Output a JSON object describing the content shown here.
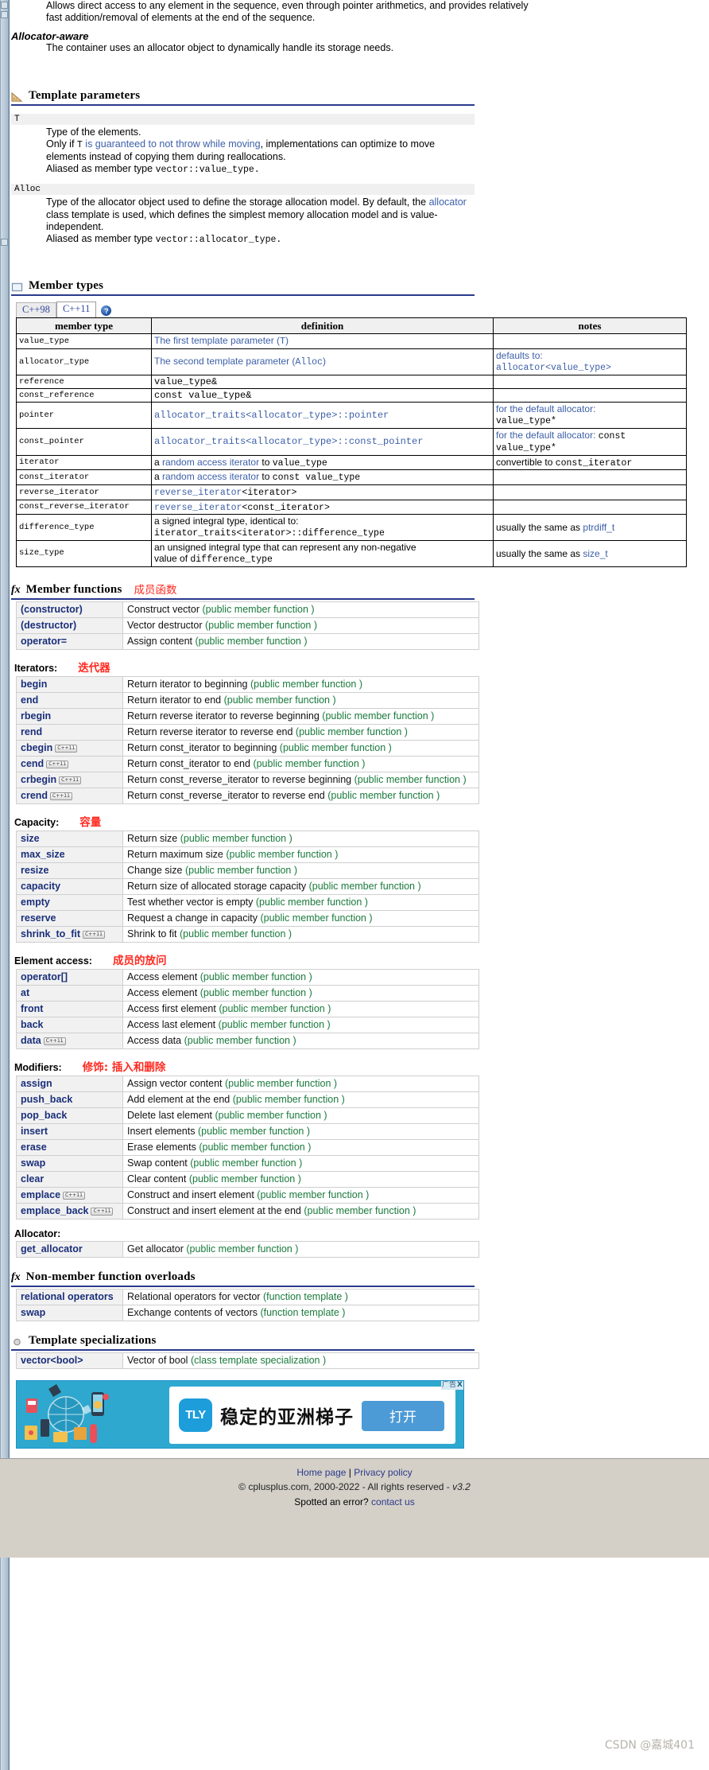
{
  "intro": {
    "line1": "Allows direct access to any element in the sequence, even through pointer arithmetics, and provides relatively",
    "line2": "fast addition/removal of elements at the end of the sequence.",
    "allocator_aware_title": "Allocator-aware",
    "allocator_aware_text": "The container uses an allocator object to dynamically handle its storage needs."
  },
  "template_parameters": {
    "heading": "Template parameters",
    "icon": "ruler-icon",
    "params": [
      {
        "name": "T",
        "lines": [
          "Type of the elements.",
          "Only if T is guaranteed to not throw while moving, implementations can optimize to move elements instead of copying them during reallocations.",
          "Aliased as member type vector::value_type."
        ],
        "l2_pre": "Only if ",
        "l2_code": "T",
        "l2_link": " is guaranteed to not throw while moving",
        "l2_post": ", implementations can optimize to move elements instead of copying them during reallocations.",
        "l3_pre": "Aliased as member type ",
        "l3_code": "vector::value_type."
      },
      {
        "name": "Alloc",
        "l1_pre": "Type of the allocator object used to define the storage allocation model. By default, the ",
        "l1_link": "allocator",
        "l1_post": " class template is used, which defines the simplest memory allocation model and is value-independent.",
        "l3_pre": "Aliased as member type ",
        "l3_code": "vector::allocator_type."
      }
    ]
  },
  "member_types": {
    "heading": "Member types",
    "icon": "book-icon",
    "tabs": [
      {
        "label": "C++98",
        "active": false
      },
      {
        "label": "C++11",
        "active": true
      }
    ],
    "help_icon": "help-icon",
    "columns": [
      "member type",
      "definition",
      "notes"
    ],
    "rows": [
      {
        "type": "value_type",
        "def_plain": "The first template parameter (T)",
        "def_style": "mixed",
        "notes": ""
      },
      {
        "type": "allocator_type",
        "def_plain": "The second template parameter (Alloc)",
        "def_style": "mixed",
        "notes": "defaults to:\nallocator<value_type>"
      },
      {
        "type": "reference",
        "def_plain": "value_type&",
        "def_style": "mono",
        "notes": ""
      },
      {
        "type": "const_reference",
        "def_plain": "const value_type&",
        "def_style": "mono",
        "notes": ""
      },
      {
        "type": "pointer",
        "def_plain": "allocator_traits<allocator_type>::pointer",
        "def_style": "monolink",
        "notes": "for the default allocator: value_type*"
      },
      {
        "type": "const_pointer",
        "def_plain": "allocator_traits<allocator_type>::const_pointer",
        "def_style": "monolink",
        "notes": "for the default allocator: const value_type*"
      },
      {
        "type": "iterator",
        "def_plain": "a random access iterator to value_type",
        "def_style": "iter",
        "notes": "convertible to const_iterator"
      },
      {
        "type": "const_iterator",
        "def_plain": "a random access iterator to const value_type",
        "def_style": "iter",
        "notes": ""
      },
      {
        "type": "reverse_iterator",
        "def_plain": "reverse_iterator<iterator>",
        "def_style": "monolink",
        "notes": ""
      },
      {
        "type": "const_reverse_iterator",
        "def_plain": "reverse_iterator<const_iterator>",
        "def_style": "monolink",
        "notes": ""
      },
      {
        "type": "difference_type",
        "def_plain": "a signed integral type, identical to:\niterator_traits<iterator>::difference_type",
        "def_style": "two",
        "notes": "usually the same as ptrdiff_t"
      },
      {
        "type": "size_type",
        "def_plain": "an unsigned integral type that can represent any non-negative value of difference_type",
        "def_style": "two2",
        "notes": "usually the same as size_t"
      }
    ]
  },
  "member_functions": {
    "heading": "Member functions",
    "icon": "fx-icon",
    "cn_note": "成员函数",
    "top": [
      {
        "fn": "(constructor)",
        "desc": "Construct vector",
        "kind": "(public member function )"
      },
      {
        "fn": "(destructor)",
        "desc": "Vector destructor",
        "kind": "(public member function )"
      },
      {
        "fn": "operator=",
        "desc": "Assign content",
        "kind": "(public member function )"
      }
    ],
    "groups": [
      {
        "title": "Iterators:",
        "cn_note": "迭代器",
        "rows": [
          {
            "fn": "begin",
            "badge": "",
            "desc": "Return iterator to beginning",
            "kind": "(public member function )"
          },
          {
            "fn": "end",
            "badge": "",
            "desc": "Return iterator to end",
            "kind": "(public member function )"
          },
          {
            "fn": "rbegin",
            "badge": "",
            "desc": "Return reverse iterator to reverse beginning",
            "kind": "(public member function )"
          },
          {
            "fn": "rend",
            "badge": "",
            "desc": "Return reverse iterator to reverse end",
            "kind": "(public member function )"
          },
          {
            "fn": "cbegin",
            "badge": "C++11",
            "desc": "Return const_iterator to beginning",
            "kind": "(public member function )"
          },
          {
            "fn": "cend",
            "badge": "C++11",
            "desc": "Return const_iterator to end",
            "kind": "(public member function )"
          },
          {
            "fn": "crbegin",
            "badge": "C++11",
            "desc": "Return const_reverse_iterator to reverse beginning",
            "kind": "(public member function )"
          },
          {
            "fn": "crend",
            "badge": "C++11",
            "desc": "Return const_reverse_iterator to reverse end",
            "kind": "(public member function )"
          }
        ]
      },
      {
        "title": "Capacity:",
        "cn_note": "容量",
        "rows": [
          {
            "fn": "size",
            "badge": "",
            "desc": "Return size",
            "kind": "(public member function )"
          },
          {
            "fn": "max_size",
            "badge": "",
            "desc": "Return maximum size",
            "kind": "(public member function )"
          },
          {
            "fn": "resize",
            "badge": "",
            "desc": "Change size",
            "kind": "(public member function )"
          },
          {
            "fn": "capacity",
            "badge": "",
            "desc": "Return size of allocated storage capacity",
            "kind": "(public member function )"
          },
          {
            "fn": "empty",
            "badge": "",
            "desc": "Test whether vector is empty",
            "kind": "(public member function )"
          },
          {
            "fn": "reserve",
            "badge": "",
            "desc": "Request a change in capacity",
            "kind": "(public member function )"
          },
          {
            "fn": "shrink_to_fit",
            "badge": "C++11",
            "desc": "Shrink to fit",
            "kind": "(public member function )"
          }
        ]
      },
      {
        "title": "Element access:",
        "cn_note": "成员的放问",
        "rows": [
          {
            "fn": "operator[]",
            "badge": "",
            "desc": "Access element",
            "kind": "(public member function )"
          },
          {
            "fn": "at",
            "badge": "",
            "desc": "Access element",
            "kind": "(public member function )"
          },
          {
            "fn": "front",
            "badge": "",
            "desc": "Access first element",
            "kind": "(public member function )"
          },
          {
            "fn": "back",
            "badge": "",
            "desc": "Access last element",
            "kind": "(public member function )"
          },
          {
            "fn": "data",
            "badge": "C++11",
            "desc": "Access data",
            "kind": "(public member function )"
          }
        ]
      },
      {
        "title": "Modifiers:",
        "cn_note": "修饰: 插入和删除",
        "rows": [
          {
            "fn": "assign",
            "badge": "",
            "desc": "Assign vector content",
            "kind": "(public member function )"
          },
          {
            "fn": "push_back",
            "badge": "",
            "desc": "Add element at the end",
            "kind": "(public member function )"
          },
          {
            "fn": "pop_back",
            "badge": "",
            "desc": "Delete last element",
            "kind": "(public member function )"
          },
          {
            "fn": "insert",
            "badge": "",
            "desc": "Insert elements",
            "kind": "(public member function )"
          },
          {
            "fn": "erase",
            "badge": "",
            "desc": "Erase elements",
            "kind": "(public member function )"
          },
          {
            "fn": "swap",
            "badge": "",
            "desc": "Swap content",
            "kind": "(public member function )"
          },
          {
            "fn": "clear",
            "badge": "",
            "desc": "Clear content",
            "kind": "(public member function )"
          },
          {
            "fn": "emplace",
            "badge": "C++11",
            "desc": "Construct and insert element",
            "kind": "(public member function )"
          },
          {
            "fn": "emplace_back",
            "badge": "C++11",
            "desc": "Construct and insert element at the end",
            "kind": "(public member function )"
          }
        ]
      },
      {
        "title": "Allocator:",
        "cn_note": "",
        "rows": [
          {
            "fn": "get_allocator",
            "badge": "",
            "desc": "Get allocator",
            "kind": "(public member function )"
          }
        ]
      }
    ]
  },
  "non_member": {
    "heading": "Non-member function overloads",
    "icon": "fx-icon",
    "rows": [
      {
        "fn": "relational operators",
        "desc": "Relational operators for vector",
        "kind": "(function template )"
      },
      {
        "fn": "swap",
        "desc": "Exchange contents of vectors",
        "kind": "(function template )"
      }
    ]
  },
  "template_specializations": {
    "heading": "Template specializations",
    "icon": "circle-icon",
    "rows": [
      {
        "fn": "vector<bool>",
        "desc": "Vector of bool",
        "kind": "(class template specialization )"
      }
    ]
  },
  "ad": {
    "tag_label": "广告",
    "close_label": "X",
    "logo": "TLY",
    "headline": "稳定的亚洲梯子",
    "button": "打开"
  },
  "footer": {
    "home_page": "Home page",
    "separator": "|",
    "privacy_policy": "Privacy policy",
    "copyright_pre": "© cplusplus.com, 2000-2022 - All rights reserved - ",
    "version": "v3.2",
    "spotted_pre": "Spotted an error? ",
    "contact": "contact us",
    "watermark": "CSDN @嘉城401"
  },
  "colors": {
    "link": "#3c5fa8",
    "heading_rule": "#2b3a8c",
    "fn_name": "#1a2f7a",
    "pmf_green": "#1a7a3c",
    "cn_red": "#ff2a20",
    "footer_bg": "#d4d0c8",
    "ad_bg": "#2fa8cf"
  }
}
